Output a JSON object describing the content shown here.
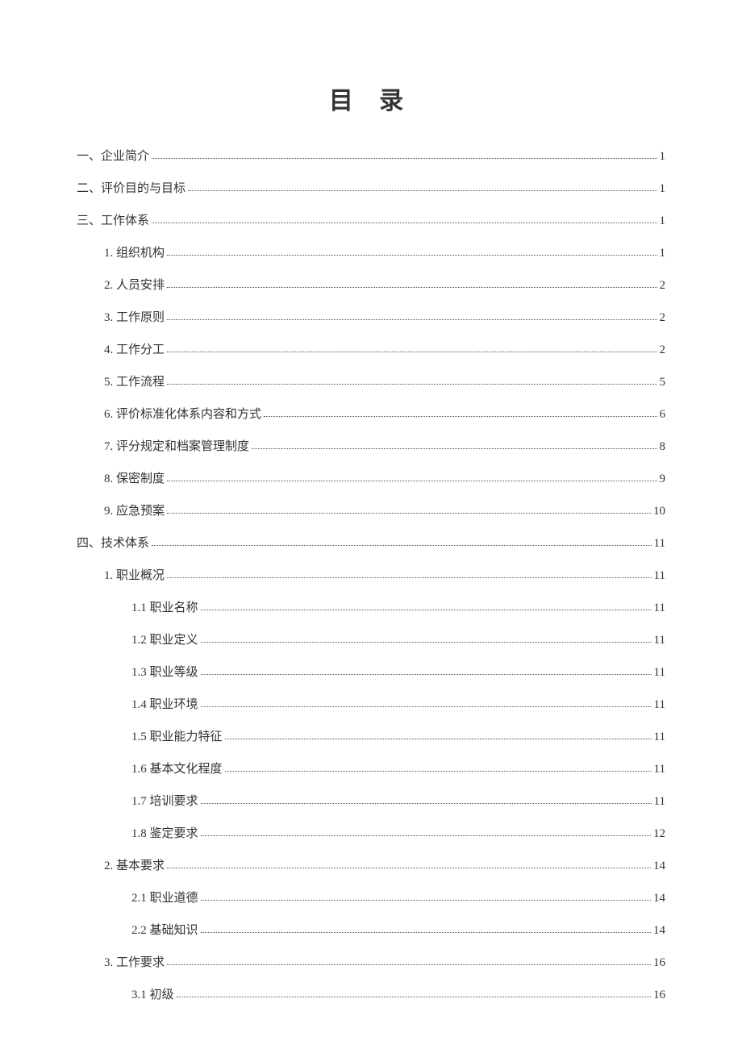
{
  "title": "目 录",
  "entries": [
    {
      "label": "一、企业简介",
      "page": "1",
      "level": 0
    },
    {
      "label": "二、评价目的与目标",
      "page": "1",
      "level": 0
    },
    {
      "label": "三、工作体系",
      "page": "1",
      "level": 0
    },
    {
      "label": "1. 组织机构",
      "page": "1",
      "level": 1
    },
    {
      "label": "2. 人员安排",
      "page": "2",
      "level": 1
    },
    {
      "label": "3. 工作原则",
      "page": "2",
      "level": 1
    },
    {
      "label": "4. 工作分工",
      "page": "2",
      "level": 1
    },
    {
      "label": "5. 工作流程",
      "page": "5",
      "level": 1
    },
    {
      "label": "6. 评价标准化体系内容和方式",
      "page": "6",
      "level": 1
    },
    {
      "label": "7. 评分规定和档案管理制度",
      "page": "8",
      "level": 1
    },
    {
      "label": "8. 保密制度",
      "page": "9",
      "level": 1
    },
    {
      "label": "9. 应急预案",
      "page": "10",
      "level": 1
    },
    {
      "label": "四、技术体系",
      "page": "11",
      "level": 0
    },
    {
      "label": "1. 职业概况",
      "page": "11",
      "level": 1
    },
    {
      "label": "1.1 职业名称",
      "page": "11",
      "level": 2
    },
    {
      "label": "1.2 职业定义",
      "page": "11",
      "level": 2
    },
    {
      "label": "1.3 职业等级",
      "page": "11",
      "level": 2
    },
    {
      "label": "1.4 职业环境",
      "page": "11",
      "level": 2
    },
    {
      "label": "1.5 职业能力特征",
      "page": "11",
      "level": 2
    },
    {
      "label": "1.6 基本文化程度",
      "page": "11",
      "level": 2
    },
    {
      "label": "1.7 培训要求",
      "page": "11",
      "level": 2
    },
    {
      "label": "1.8 鉴定要求",
      "page": "12",
      "level": 2
    },
    {
      "label": "2. 基本要求",
      "page": "14",
      "level": 1
    },
    {
      "label": "2.1 职业道德",
      "page": "14",
      "level": 2
    },
    {
      "label": "2.2 基础知识",
      "page": "14",
      "level": 2
    },
    {
      "label": "3. 工作要求",
      "page": "16",
      "level": 1
    },
    {
      "label": "3.1 初级",
      "page": "16",
      "level": 2
    }
  ]
}
